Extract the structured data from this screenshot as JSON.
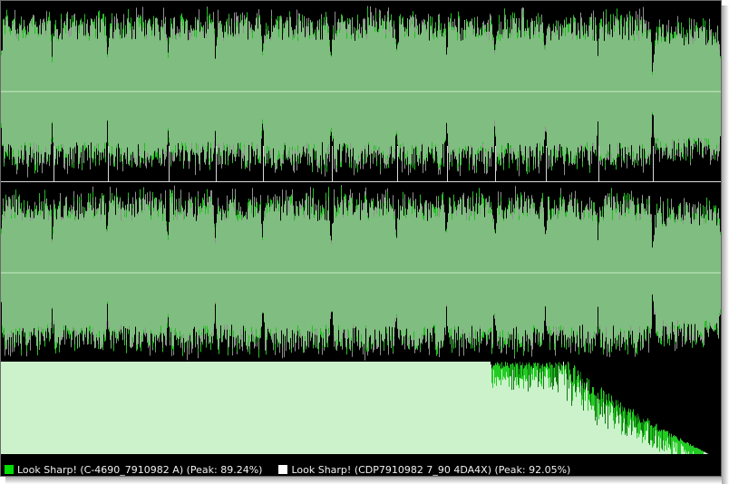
{
  "colors": {
    "background": "#000000",
    "waveform_fill": "#80bd80",
    "trackA": "#22c022",
    "trackB": "#ffffff",
    "gray_overlay": "#909090",
    "spectrum_fill": "#ccf2cc",
    "center_line": "#c8ecc8"
  },
  "tracks": [
    {
      "label": "Look Sharp! (C-4690_7910982 A) (Peak: 89.24%)",
      "peak_percent": 89.24,
      "swatch_color": "#00dd00"
    },
    {
      "label": "Look Sharp! (CDP7910982 7_90 4DA4X) (Peak: 92.05%)",
      "peak_percent": 92.05,
      "swatch_color": "#ffffff"
    }
  ]
}
